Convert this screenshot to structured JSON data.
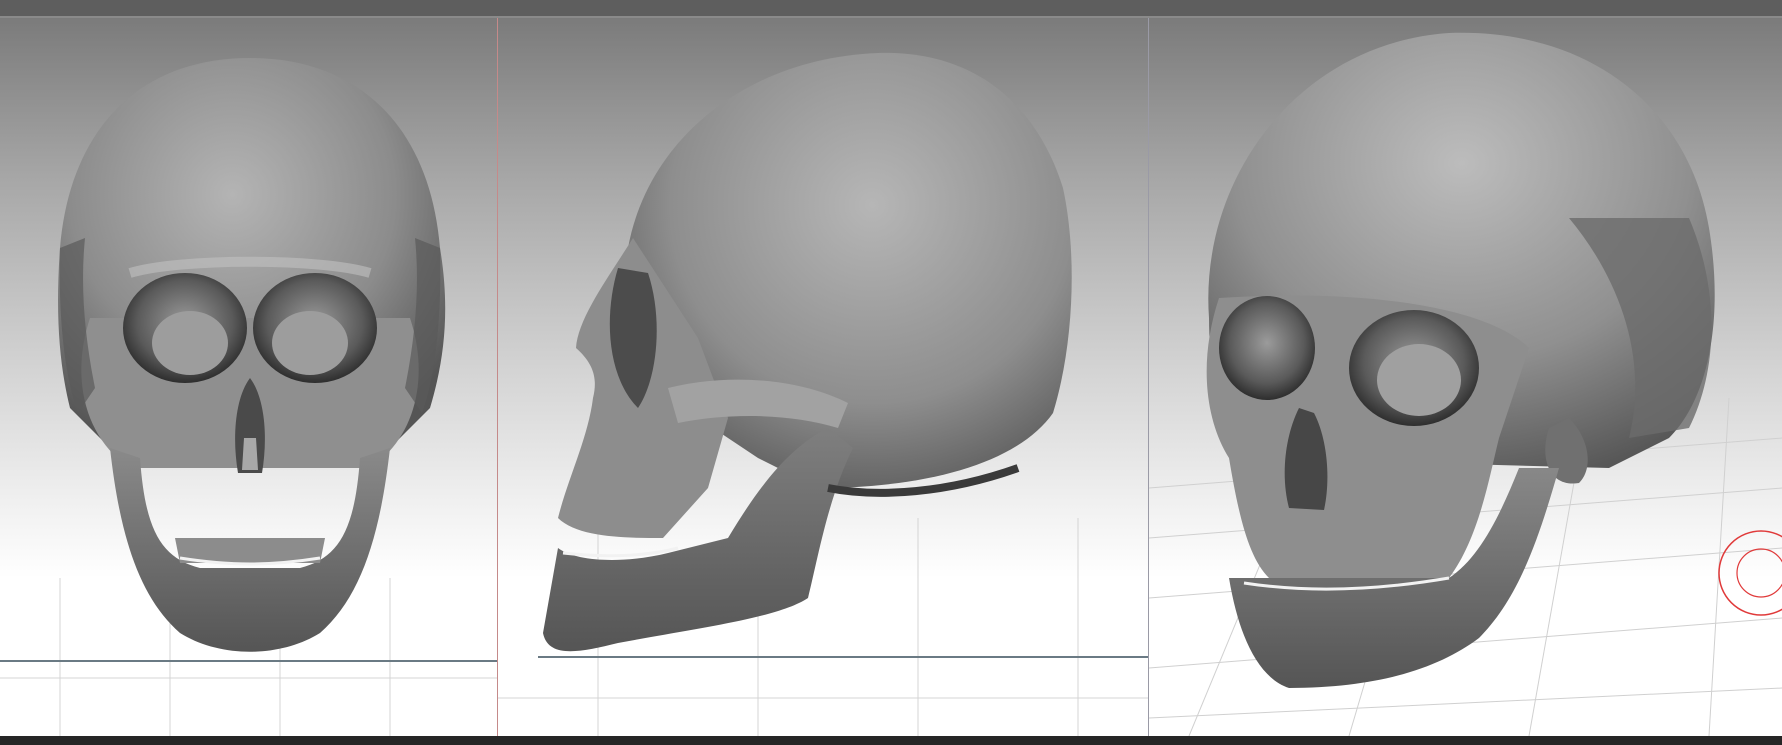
{
  "app": {
    "panels": [
      "front-view",
      "side-view",
      "perspective-view"
    ]
  },
  "theme": {
    "skull_base": "#8a8a8a",
    "skull_light": "#c9c9c9",
    "skull_dark": "#3a3a3a",
    "grid_color": "#c8c8c8",
    "horizon_color": "#6a7a84",
    "divider_color": "#c58a8a",
    "gizmo_color": "#e03a3a"
  },
  "icons": [
    "rotate-gizmo-icon"
  ]
}
